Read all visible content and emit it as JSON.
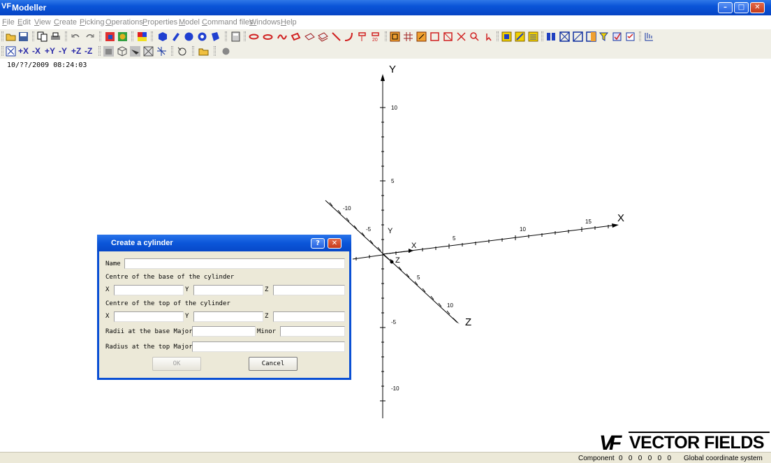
{
  "window": {
    "title": "Modeller",
    "app_icon": "VF"
  },
  "menu": [
    "File",
    "Edit",
    "View",
    "Create",
    "Picking",
    "Operations",
    "Properties",
    "Model",
    "Command files",
    "Windows",
    "Help"
  ],
  "view_buttons": [
    "+X",
    "-X",
    "+Y",
    "-Y",
    "+Z",
    "-Z"
  ],
  "timestamp": "10/??/2009 08:24:03",
  "axes": {
    "y_label": "Y",
    "x_label": "X",
    "z_label": "Z",
    "y_ticks": [
      "10",
      "5",
      "-5",
      "-10"
    ],
    "x_ticks": [
      "5",
      "10",
      "15"
    ],
    "z_ticks": [
      "5",
      "10",
      "-5",
      "-10"
    ],
    "small_y": "Y",
    "small_x": "X",
    "small_z": "Z"
  },
  "dialog": {
    "title": "Create a cylinder",
    "help_glyph": "?",
    "close_glyph": "✕",
    "name_label": "Name",
    "base_heading": "Centre of the base of the cylinder",
    "top_heading": "Centre of the top of the cylinder",
    "x_label": "X",
    "y_label": "Y",
    "z_label": "Z",
    "radii_base_label": "Radii at the base Major",
    "minor_label": "Minor",
    "radius_top_label": "Radius at the top Major",
    "ok_label": "OK",
    "cancel_label": "Cancel"
  },
  "logo": {
    "mark": "VF",
    "word": "VECTOR FIELDS"
  },
  "status": {
    "component_label": "Component",
    "values": "0   0   0   0   0   0",
    "coord_system": "Global coordinate system"
  },
  "colors": {
    "titlebar": "#0a55d8",
    "dialog_border": "#0a4fd4",
    "toolbar": "#f0efe6",
    "view_text": "#2a2aa8"
  }
}
